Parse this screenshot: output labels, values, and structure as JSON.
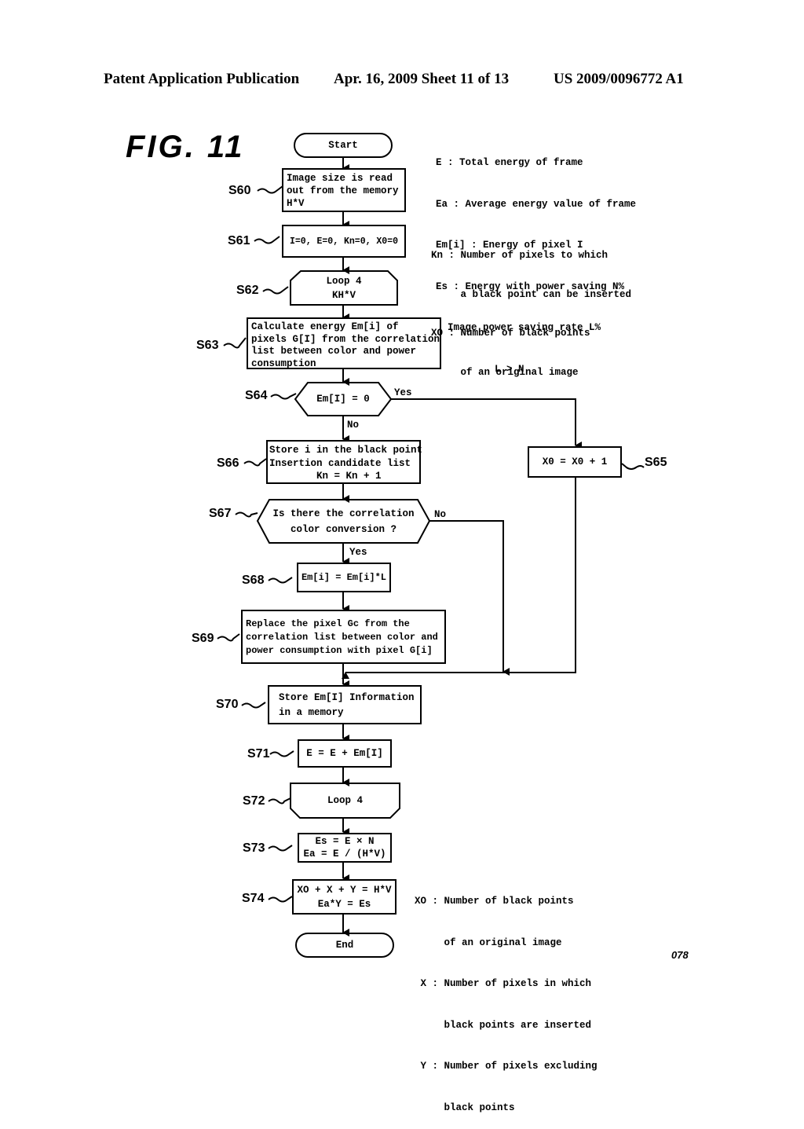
{
  "header": {
    "publication": "Patent Application Publication",
    "date_sheet": "Apr. 16, 2009  Sheet 11 of 13",
    "patent_number": "US 2009/0096772 A1"
  },
  "figure_label": "FIG. 11",
  "legend_top": [
    "E : Total energy of frame",
    "Ea : Average energy value of frame",
    "Em[i] : Energy of pixel I",
    "Es : Energy with power saving N%",
    "  Image power saving rate L%",
    "          L > N"
  ],
  "legend_mid": [
    "Kn : Number of pixels to which",
    "     a black point can be inserted",
    "XO : Number of black points",
    "     of an original image"
  ],
  "legend_bottom": [
    "XO : Number of black points",
    "     of an original image",
    " X : Number of pixels in which",
    "     black points are inserted",
    " Y : Number of pixels excluding",
    "     black points"
  ],
  "nodes": {
    "start": "Start",
    "s60": "Image size is read\nout from the memory\nH*V",
    "s61": "I=0, E=0, Kn=0, X0=0",
    "s62": "Loop 4\nKH*V",
    "s63": "Calculate energy Em[i] of\npixels G[I] from the correlation\nlist between color and power\nconsumption",
    "s64": "Em[I] = 0",
    "s65": "X0 = X0 + 1",
    "s66": "Store i in the black point\nInsertion candidate list\n        Kn = Kn + 1",
    "s67": "Is there the correlation\ncolor conversion ?",
    "s68": "Em[i] = Em[i]*L",
    "s69": "Replace the pixel Gc from the\ncorrelation list between color and\npower consumption with pixel G[i]",
    "s70": "Store Em[I] Information\nin a memory",
    "s71": "E = E + Em[I]",
    "s72": "Loop 4",
    "s73": "Es = E × N\nEa = E / (H*V)",
    "s74": "XO + X + Y = H*V\nEa*Y = Es",
    "end": "End"
  },
  "step_labels": {
    "s60": "S60",
    "s61": "S61",
    "s62": "S62",
    "s63": "S63",
    "s64": "S64",
    "s65": "S65",
    "s66": "S66",
    "s67": "S67",
    "s68": "S68",
    "s69": "S69",
    "s70": "S70",
    "s71": "S71",
    "s72": "S72",
    "s73": "S73",
    "s74": "S74"
  },
  "branch_labels": {
    "s64_yes": "Yes",
    "s64_no": "No",
    "s67_no": "No",
    "s67_yes": "Yes"
  },
  "page_code": "078"
}
